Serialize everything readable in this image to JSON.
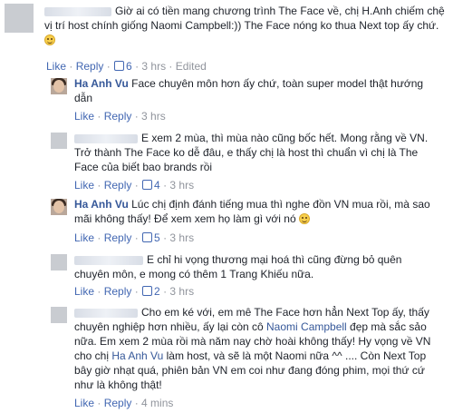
{
  "comments": [
    {
      "text": "Giờ ai có tiền mang chương trình The Face về, chị H.Anh chiếm chệ vị trí host chính giống Naomi Campbell:)) The Face nóng ko thua Next top ấy chứ.",
      "like": "Like",
      "reply": "Reply",
      "likes": "6",
      "time": "3 hrs",
      "edited": "Edited"
    },
    {
      "name": "Ha Anh Vu",
      "text": "Face chuyên môn hơn ấy chứ, toàn super model thật hướng dẫn",
      "like": "Like",
      "reply": "Reply",
      "time": "3 hrs"
    },
    {
      "text": "E xem 2 mùa, thì mùa nào cũng bốc hết. Mong rằng về VN. Trở thành The Face ko dễ đâu, e thấy chị là host thì chuẩn vì chị là The Face của biết bao brands rồi",
      "like": "Like",
      "reply": "Reply",
      "likes": "4",
      "time": "3 hrs"
    },
    {
      "name": "Ha Anh Vu",
      "text": "Lúc chị định đánh tiếng mua thì nghe đồn VN mua rồi, mà sao mãi không thấy! Để xem xem họ làm gì với nó",
      "like": "Like",
      "reply": "Reply",
      "likes": "5",
      "time": "3 hrs"
    },
    {
      "text": "E chỉ hi vọng thương mại hoá thì cũng đừng bỏ quên chuyên môn, e mong có thêm 1 Trang Khiếu nữa.",
      "like": "Like",
      "reply": "Reply",
      "likes": "2",
      "time": "3 hrs"
    },
    {
      "text_a": "Cho em ké với, em mê The Face hơn hẳn Next Top ấy, thấy chuyên nghiệp hơn nhiều, ấy lại còn cô ",
      "mention1": "Naomi Campbell",
      "text_b": " đẹp mà sắc sảo nữa. Em xem 2 mùa rồi mà năm nay chờ hoài không thấy! Hy vọng về VN cho chị ",
      "mention2": "Ha Anh Vu",
      "text_c": " làm host, và sẽ là một Naomi nữa ^^ .... Còn Next Top bây giờ nhạt quá, phiên bản VN em coi như đang đóng phim, mọi thứ cứ như là không thật!",
      "like": "Like",
      "reply": "Reply",
      "time": "4 mins"
    }
  ]
}
